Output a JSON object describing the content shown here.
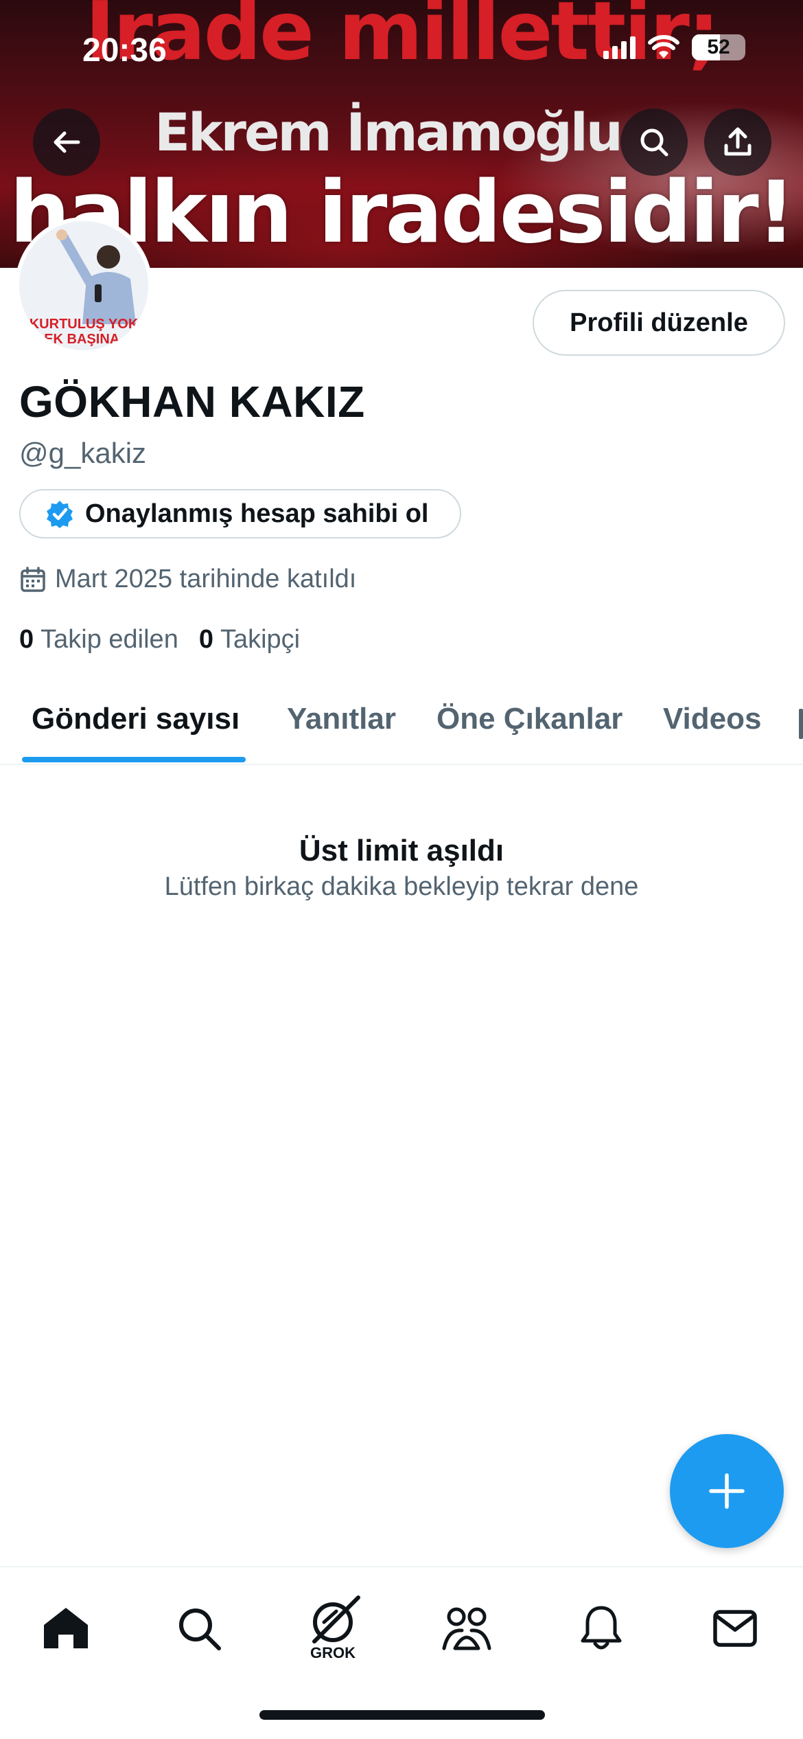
{
  "status_bar": {
    "time": "20:36",
    "battery": "52"
  },
  "banner": {
    "line1": "İrade millettir;",
    "line2": "Ekrem İmamoğlu",
    "line3": "halkın iradesidir!"
  },
  "avatar": {
    "caption_line1": "KURTULUŞ YOK",
    "caption_line2": "EK BAŞINA."
  },
  "profile": {
    "edit_label": "Profili düzenle",
    "name": "GÖKHAN KAKIZ",
    "handle": "@g_kakiz",
    "verify_label": "Onaylanmış hesap sahibi ol",
    "joined": "Mart 2025 tarihinde katıldı",
    "following_count": "0",
    "following_label": "Takip edilen",
    "followers_count": "0",
    "followers_label": "Takipçi"
  },
  "tabs": [
    {
      "label": "Gönderi sayısı",
      "active": true
    },
    {
      "label": "Yanıtlar",
      "active": false
    },
    {
      "label": "Öne Çıkanlar",
      "active": false
    },
    {
      "label": "Videos",
      "active": false
    }
  ],
  "empty_state": {
    "title": "Üst limit aşıldı",
    "subtitle": "Lütfen birkaç dakika bekleyip tekrar dene"
  },
  "bottom_nav": {
    "items": [
      "home-icon",
      "search-icon",
      "grok-icon",
      "communities-icon",
      "notifications-icon",
      "messages-icon"
    ],
    "grok_label": "GROK"
  },
  "colors": {
    "accent": "#1d9bf0",
    "text": "#0f1419",
    "muted": "#536471",
    "banner_red": "#d61f26"
  }
}
